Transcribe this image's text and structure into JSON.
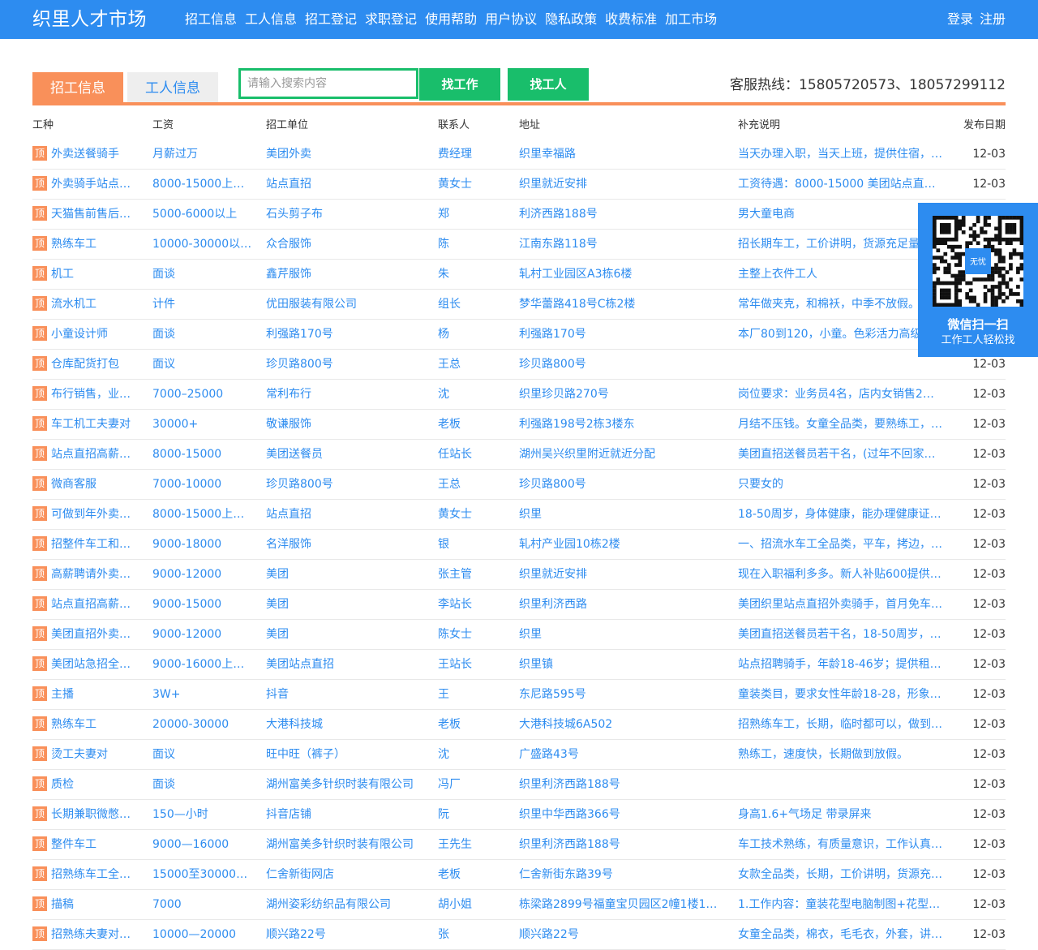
{
  "site": {
    "brand": "织里人才市场",
    "nav": [
      "招工信息",
      "工人信息",
      "招工登记",
      "求职登记",
      "使用帮助",
      "用户协议",
      "隐私政策",
      "收费标准",
      "加工市场"
    ],
    "login": "登录",
    "register": "注册"
  },
  "toolbar": {
    "tab_jobs": "招工信息",
    "tab_workers": "工人信息",
    "search_placeholder": "请输入搜索内容",
    "find_job": "找工作",
    "find_worker": "找工人",
    "hotline": "客服热线：15805720573、18057299112"
  },
  "qr": {
    "title": "微信扫一扫",
    "subtitle": "工作工人轻松找",
    "logo_text": "无忧"
  },
  "columns": [
    "工种",
    "工资",
    "招工单位",
    "联系人",
    "地址",
    "补充说明",
    "发布日期"
  ],
  "badge": "顶",
  "colors": {
    "brand_blue": "#2d8cf0",
    "orange": "#f9905a",
    "green": "#19be6b"
  },
  "rows": [
    {
      "type": "外卖送餐骑手",
      "wage": "月薪过万",
      "company": "美团外卖",
      "contact": "费经理",
      "address": "织里幸福路",
      "note": "当天办理入职，当天上班，提供住宿，…",
      "date": "12-03"
    },
    {
      "type": "外卖骑手站点…",
      "wage": "8000-15000上不…",
      "company": "站点直招",
      "contact": "黄女士",
      "address": "织里就近安排",
      "note": "工资待遇：8000-15000 美团站点直招…",
      "date": "12-03"
    },
    {
      "type": "天猫售前售后…",
      "wage": "5000-6000以上",
      "company": "石头剪子布",
      "contact": "郑",
      "address": "利济西路188号",
      "note": "男大童电商",
      "date": ""
    },
    {
      "type": "熟练车工",
      "wage": "10000-30000以…",
      "company": "众合服饰",
      "contact": "陈",
      "address": "江南东路118号",
      "note": "招长期车工，工价讲明，货源充足量",
      "date": ""
    },
    {
      "type": "机工",
      "wage": "面谈",
      "company": "鑫芹服饰",
      "contact": "朱",
      "address": "轧村工业园区A3栋6楼",
      "note": "主整上衣件工人",
      "date": ""
    },
    {
      "type": "流水机工",
      "wage": "计件",
      "company": "优田服装有限公司",
      "contact": "组长",
      "address": "梦华蕾路418号C栋2楼",
      "note": "常年做夹克，和棉袄，中季不放假。",
      "date": ""
    },
    {
      "type": "小童设计师",
      "wage": "面谈",
      "company": "利强路170号",
      "contact": "杨",
      "address": "利强路170号",
      "note": "本厂80到120，小童。色彩活力高级",
      "date": ""
    },
    {
      "type": "仓库配货打包",
      "wage": "面议",
      "company": "珍贝路800号",
      "contact": "王总",
      "address": "珍贝路800号",
      "note": "",
      "date": "12-03"
    },
    {
      "type": "布行销售，业…",
      "wage": "7000–25000",
      "company": "常利布行",
      "contact": "沈",
      "address": "织里珍贝路270号",
      "note": "岗位要求：业务员4名，店内女销售2…",
      "date": "12-03"
    },
    {
      "type": "车工机工夫妻对",
      "wage": "30000+",
      "company": "敬谦服饰",
      "contact": "老板",
      "address": "利强路198号2栋3楼东",
      "note": "月结不压钱。女童全品类，要熟练工，…",
      "date": "12-03"
    },
    {
      "type": "站点直招高薪…",
      "wage": "8000-15000",
      "company": "美团送餐员",
      "contact": "任站长",
      "address": "湖州吴兴织里附近就近分配",
      "note": "美团直招送餐员若干名，(过年不回家…",
      "date": "12-03"
    },
    {
      "type": "微商客服",
      "wage": "7000-10000",
      "company": "珍贝路800号",
      "contact": "王总",
      "address": "珍贝路800号",
      "note": "只要女的",
      "date": "12-03"
    },
    {
      "type": "可做到年外卖…",
      "wage": "8000-15000上不…",
      "company": "站点直招",
      "contact": "黄女士",
      "address": "织里",
      "note": "18-50周岁，身体健康，能办理健康证…",
      "date": "12-03"
    },
    {
      "type": "招整件车工和…",
      "wage": "9000-18000",
      "company": "名洋服饰",
      "contact": "银",
      "address": "轧村产业园10栋2楼",
      "note": "一、招流水车工全品类，平车，拷边，…",
      "date": "12-03"
    },
    {
      "type": "高薪聘请外卖…",
      "wage": "9000-12000",
      "company": "美团",
      "contact": "张主管",
      "address": "织里就近安排",
      "note": "现在入职福利多多。新人补贴600提供…",
      "date": "12-03"
    },
    {
      "type": "站点直招高薪…",
      "wage": "9000-15000",
      "company": "美团",
      "contact": "李站长",
      "address": "织里利济西路",
      "note": "美团织里站点直招外卖骑手，首月免车…",
      "date": "12-03"
    },
    {
      "type": "美团直招外卖…",
      "wage": "9000-12000",
      "company": "美团",
      "contact": "陈女士",
      "address": "织里",
      "note": "美团直招送餐员若干名，18-50周岁，…",
      "date": "12-03"
    },
    {
      "type": "美团站急招全…",
      "wage": "9000-16000上不…",
      "company": "美团站点直招",
      "contact": "王站长",
      "address": "织里镇",
      "note": "站点招聘骑手，年龄18-46岁；提供租…",
      "date": "12-03"
    },
    {
      "type": "主播",
      "wage": "3W+",
      "company": "抖音",
      "contact": "王",
      "address": "东尼路595号",
      "note": "童装类目，要求女性年龄18-28，形象…",
      "date": "12-03"
    },
    {
      "type": "熟练车工",
      "wage": "20000-30000",
      "company": "大港科技城",
      "contact": "老板",
      "address": "大港科技城6A502",
      "note": "招熟练车工，长期，临时都可以，做到…",
      "date": "12-03"
    },
    {
      "type": "烫工夫妻对",
      "wage": "面议",
      "company": "旺中旺（裤子）",
      "contact": "沈",
      "address": "广盛路43号",
      "note": "熟练工，速度快，长期做到放假。",
      "date": "12-03"
    },
    {
      "type": "质检",
      "wage": "面谈",
      "company": "湖州富美多针织时装有限公司",
      "contact": "冯厂",
      "address": "织里利济西路188号",
      "note": "",
      "date": "12-03"
    },
    {
      "type": "长期兼职微憋…",
      "wage": "150—小时",
      "company": "抖音店铺",
      "contact": "阮",
      "address": "织里中华西路366号",
      "note": "身高1.6+气场足 带录屏来",
      "date": "12-03"
    },
    {
      "type": "整件车工",
      "wage": "9000—16000",
      "company": "湖州富美多针织时装有限公司",
      "contact": "王先生",
      "address": "织里利济西路188号",
      "note": "车工技术熟练，有质量意识，工作认真…",
      "date": "12-03"
    },
    {
      "type": "招熟练车工全…",
      "wage": "15000至30000…",
      "company": "仁舍新街网店",
      "contact": "老板",
      "address": "仁舍新街东路39号",
      "note": "女款全品类，长期，工价讲明，货源充…",
      "date": "12-03"
    },
    {
      "type": "描稿",
      "wage": "7000",
      "company": "湖州姿彩纺织品有限公司",
      "contact": "胡小姐",
      "address": "栋梁路2899号福童宝贝园区2幢1楼10…",
      "note": "1.工作内容：童装花型电脑制图+花型…",
      "date": "12-03"
    },
    {
      "type": "招熟练夫妻对…",
      "wage": "10000—20000",
      "company": "顺兴路22号",
      "contact": "张",
      "address": "顺兴路22号",
      "note": "女童全品类，棉衣，毛毛衣，外套，讲…",
      "date": "12-03"
    }
  ]
}
